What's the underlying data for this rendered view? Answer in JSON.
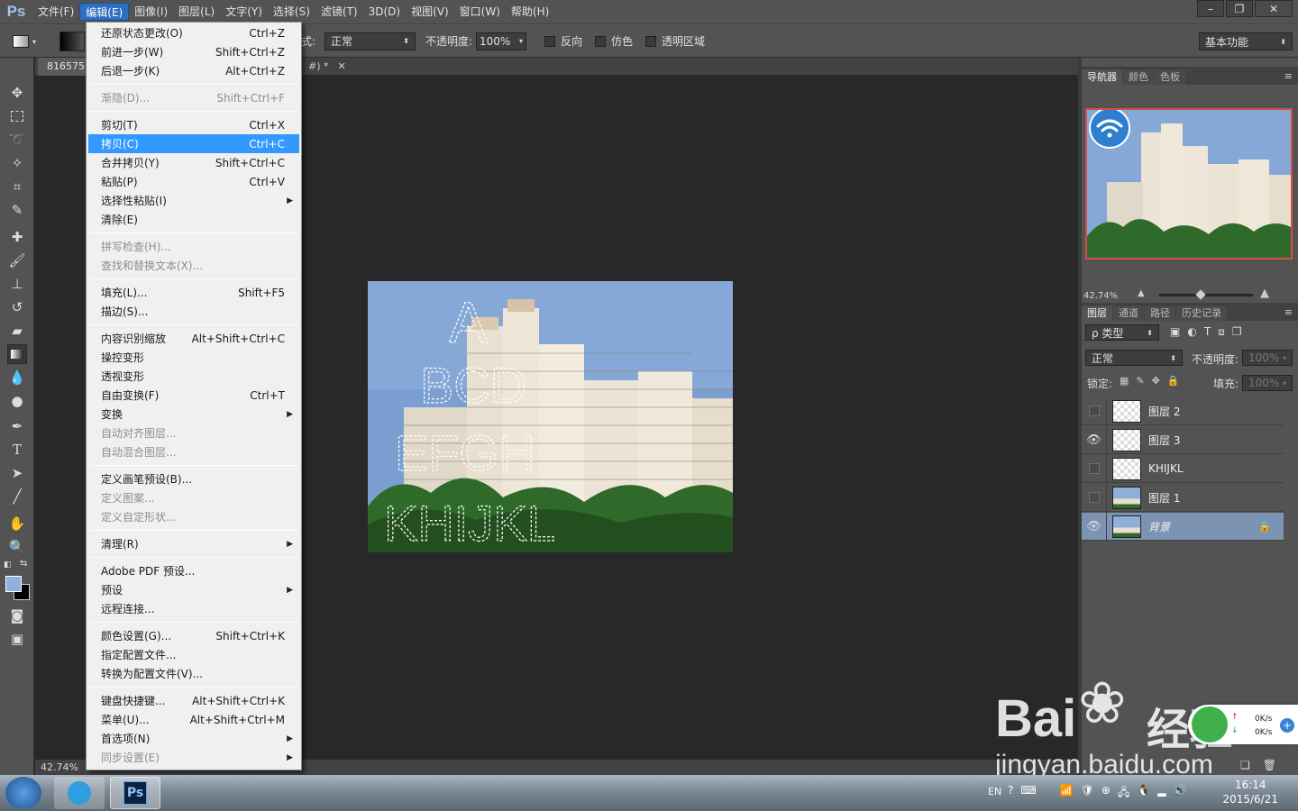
{
  "app": {
    "logo": "Ps"
  },
  "menubar": {
    "items": [
      "文件(F)",
      "编辑(E)",
      "图像(I)",
      "图层(L)",
      "文字(Y)",
      "选择(S)",
      "滤镜(T)",
      "3D(D)",
      "视图(V)",
      "窗口(W)",
      "帮助(H)"
    ],
    "active_index": 1
  },
  "window_controls": {
    "minimize": "–",
    "restore": "❐",
    "close": "✕"
  },
  "options": {
    "mode_label": "式:",
    "mode_value": "正常",
    "opacity_label": "不透明度:",
    "opacity_value": "100%",
    "reverse_label": "反向",
    "dither_label": "仿色",
    "transparency_label": "透明区域",
    "workspace": "基本功能"
  },
  "document": {
    "tab_title": "816575",
    "tab2_title": "#) *",
    "zoom_status": "42.74%"
  },
  "edit_menu": [
    {
      "label": "还原状态更改(O)",
      "shortcut": "Ctrl+Z"
    },
    {
      "label": "前进一步(W)",
      "shortcut": "Shift+Ctrl+Z"
    },
    {
      "label": "后退一步(K)",
      "shortcut": "Alt+Ctrl+Z"
    },
    {
      "label": "渐隐(D)...",
      "shortcut": "Shift+Ctrl+F",
      "disabled": true
    },
    {
      "label": "剪切(T)",
      "shortcut": "Ctrl+X"
    },
    {
      "label": "拷贝(C)",
      "shortcut": "Ctrl+C",
      "highlighted": true
    },
    {
      "label": "合并拷贝(Y)",
      "shortcut": "Shift+Ctrl+C"
    },
    {
      "label": "粘贴(P)",
      "shortcut": "Ctrl+V"
    },
    {
      "label": "选择性粘贴(I)",
      "shortcut": "",
      "submenu": true
    },
    {
      "label": "清除(E)",
      "shortcut": ""
    },
    {
      "label": "拼写检查(H)...",
      "shortcut": "",
      "disabled": true
    },
    {
      "label": "查找和替换文本(X)...",
      "shortcut": "",
      "disabled": true
    },
    {
      "label": "填充(L)...",
      "shortcut": "Shift+F5"
    },
    {
      "label": "描边(S)...",
      "shortcut": ""
    },
    {
      "label": "内容识别缩放",
      "shortcut": "Alt+Shift+Ctrl+C"
    },
    {
      "label": "操控变形",
      "shortcut": ""
    },
    {
      "label": "透视变形",
      "shortcut": ""
    },
    {
      "label": "自由变换(F)",
      "shortcut": "Ctrl+T"
    },
    {
      "label": "变换",
      "shortcut": "",
      "submenu": true
    },
    {
      "label": "自动对齐图层...",
      "shortcut": "",
      "disabled": true
    },
    {
      "label": "自动混合图层...",
      "shortcut": "",
      "disabled": true
    },
    {
      "label": "定义画笔预设(B)...",
      "shortcut": ""
    },
    {
      "label": "定义图案...",
      "shortcut": "",
      "disabled": true
    },
    {
      "label": "定义自定形状...",
      "shortcut": "",
      "disabled": true
    },
    {
      "label": "清理(R)",
      "shortcut": "",
      "submenu": true
    },
    {
      "label": "Adobe PDF 预设...",
      "shortcut": ""
    },
    {
      "label": "预设",
      "shortcut": "",
      "submenu": true
    },
    {
      "label": "远程连接...",
      "shortcut": ""
    },
    {
      "label": "颜色设置(G)...",
      "shortcut": "Shift+Ctrl+K"
    },
    {
      "label": "指定配置文件...",
      "shortcut": ""
    },
    {
      "label": "转换为配置文件(V)...",
      "shortcut": ""
    },
    {
      "label": "键盘快捷键...",
      "shortcut": "Alt+Shift+Ctrl+K"
    },
    {
      "label": "菜单(U)...",
      "shortcut": "Alt+Shift+Ctrl+M"
    },
    {
      "label": "首选项(N)",
      "shortcut": "",
      "submenu": true
    },
    {
      "label": "同步设置(E)",
      "shortcut": "",
      "submenu": true,
      "disabled": true
    }
  ],
  "navigator": {
    "tabs": [
      "导航器",
      "颜色",
      "色板"
    ],
    "zoom": "42.74%"
  },
  "layers_panel": {
    "tabs": [
      "图层",
      "通道",
      "路径",
      "历史记录"
    ],
    "filter_label": "ρ 类型",
    "blend_mode": "正常",
    "opacity_label": "不透明度:",
    "opacity_value": "100%",
    "lock_label": "锁定:",
    "fill_label": "填充:",
    "fill_value": "100%",
    "layers": [
      {
        "name": "图层 2",
        "visible": false
      },
      {
        "name": "图层 3",
        "visible": true
      },
      {
        "name": "KHIJKL",
        "visible": false
      },
      {
        "name": "图层 1",
        "visible": false
      },
      {
        "name": "背景",
        "visible": true,
        "locked": true,
        "selected": true
      }
    ]
  },
  "net_widget": {
    "up": "0K/s",
    "down": "0K/s"
  },
  "watermark": {
    "brand": "Bai",
    "cn": "经验",
    "url": "jingyan.baidu.com"
  },
  "taskbar": {
    "lang": "EN",
    "time": "16:14",
    "date": "2015/6/21"
  },
  "colors": {
    "menu_highlight": "#3399ff",
    "foreground": "#8fb2dc",
    "background": "#000000",
    "nav_border": "#d84b4b",
    "selected_layer": "#7c93b3"
  }
}
